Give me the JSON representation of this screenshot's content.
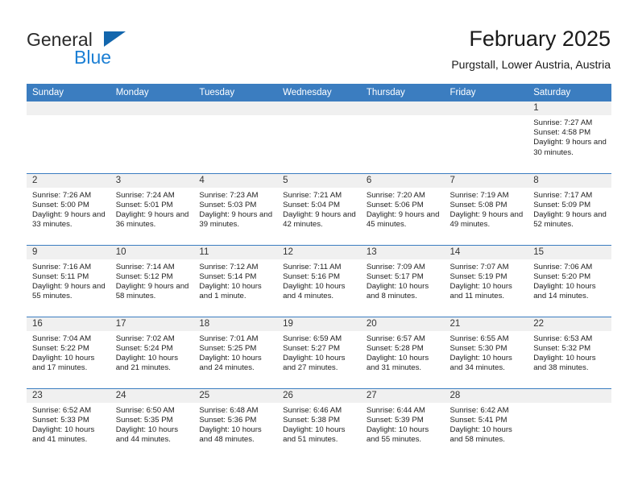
{
  "brand": {
    "name_part1": "General",
    "name_part2": "Blue",
    "triangle_color": "#1266ad",
    "blue_color": "#1b7fd4"
  },
  "header": {
    "title": "February 2025",
    "subtitle": "Purgstall, Lower Austria, Austria"
  },
  "theme": {
    "header_bar": "#3b7dc0",
    "day_band": "#f0f0f0",
    "row_rule": "#3b7dc0"
  },
  "weekdays": [
    "Sunday",
    "Monday",
    "Tuesday",
    "Wednesday",
    "Thursday",
    "Friday",
    "Saturday"
  ],
  "weeks": [
    [
      {
        "day": "",
        "sunrise": "",
        "sunset": "",
        "daylight": "",
        "empty": true
      },
      {
        "day": "",
        "sunrise": "",
        "sunset": "",
        "daylight": "",
        "empty": true
      },
      {
        "day": "",
        "sunrise": "",
        "sunset": "",
        "daylight": "",
        "empty": true
      },
      {
        "day": "",
        "sunrise": "",
        "sunset": "",
        "daylight": "",
        "empty": true
      },
      {
        "day": "",
        "sunrise": "",
        "sunset": "",
        "daylight": "",
        "empty": true
      },
      {
        "day": "",
        "sunrise": "",
        "sunset": "",
        "daylight": "",
        "empty": true
      },
      {
        "day": "1",
        "sunrise": "Sunrise: 7:27 AM",
        "sunset": "Sunset: 4:58 PM",
        "daylight": "Daylight: 9 hours and 30 minutes."
      }
    ],
    [
      {
        "day": "2",
        "sunrise": "Sunrise: 7:26 AM",
        "sunset": "Sunset: 5:00 PM",
        "daylight": "Daylight: 9 hours and 33 minutes."
      },
      {
        "day": "3",
        "sunrise": "Sunrise: 7:24 AM",
        "sunset": "Sunset: 5:01 PM",
        "daylight": "Daylight: 9 hours and 36 minutes."
      },
      {
        "day": "4",
        "sunrise": "Sunrise: 7:23 AM",
        "sunset": "Sunset: 5:03 PM",
        "daylight": "Daylight: 9 hours and 39 minutes."
      },
      {
        "day": "5",
        "sunrise": "Sunrise: 7:21 AM",
        "sunset": "Sunset: 5:04 PM",
        "daylight": "Daylight: 9 hours and 42 minutes."
      },
      {
        "day": "6",
        "sunrise": "Sunrise: 7:20 AM",
        "sunset": "Sunset: 5:06 PM",
        "daylight": "Daylight: 9 hours and 45 minutes."
      },
      {
        "day": "7",
        "sunrise": "Sunrise: 7:19 AM",
        "sunset": "Sunset: 5:08 PM",
        "daylight": "Daylight: 9 hours and 49 minutes."
      },
      {
        "day": "8",
        "sunrise": "Sunrise: 7:17 AM",
        "sunset": "Sunset: 5:09 PM",
        "daylight": "Daylight: 9 hours and 52 minutes."
      }
    ],
    [
      {
        "day": "9",
        "sunrise": "Sunrise: 7:16 AM",
        "sunset": "Sunset: 5:11 PM",
        "daylight": "Daylight: 9 hours and 55 minutes."
      },
      {
        "day": "10",
        "sunrise": "Sunrise: 7:14 AM",
        "sunset": "Sunset: 5:12 PM",
        "daylight": "Daylight: 9 hours and 58 minutes."
      },
      {
        "day": "11",
        "sunrise": "Sunrise: 7:12 AM",
        "sunset": "Sunset: 5:14 PM",
        "daylight": "Daylight: 10 hours and 1 minute."
      },
      {
        "day": "12",
        "sunrise": "Sunrise: 7:11 AM",
        "sunset": "Sunset: 5:16 PM",
        "daylight": "Daylight: 10 hours and 4 minutes."
      },
      {
        "day": "13",
        "sunrise": "Sunrise: 7:09 AM",
        "sunset": "Sunset: 5:17 PM",
        "daylight": "Daylight: 10 hours and 8 minutes."
      },
      {
        "day": "14",
        "sunrise": "Sunrise: 7:07 AM",
        "sunset": "Sunset: 5:19 PM",
        "daylight": "Daylight: 10 hours and 11 minutes."
      },
      {
        "day": "15",
        "sunrise": "Sunrise: 7:06 AM",
        "sunset": "Sunset: 5:20 PM",
        "daylight": "Daylight: 10 hours and 14 minutes."
      }
    ],
    [
      {
        "day": "16",
        "sunrise": "Sunrise: 7:04 AM",
        "sunset": "Sunset: 5:22 PM",
        "daylight": "Daylight: 10 hours and 17 minutes."
      },
      {
        "day": "17",
        "sunrise": "Sunrise: 7:02 AM",
        "sunset": "Sunset: 5:24 PM",
        "daylight": "Daylight: 10 hours and 21 minutes."
      },
      {
        "day": "18",
        "sunrise": "Sunrise: 7:01 AM",
        "sunset": "Sunset: 5:25 PM",
        "daylight": "Daylight: 10 hours and 24 minutes."
      },
      {
        "day": "19",
        "sunrise": "Sunrise: 6:59 AM",
        "sunset": "Sunset: 5:27 PM",
        "daylight": "Daylight: 10 hours and 27 minutes."
      },
      {
        "day": "20",
        "sunrise": "Sunrise: 6:57 AM",
        "sunset": "Sunset: 5:28 PM",
        "daylight": "Daylight: 10 hours and 31 minutes."
      },
      {
        "day": "21",
        "sunrise": "Sunrise: 6:55 AM",
        "sunset": "Sunset: 5:30 PM",
        "daylight": "Daylight: 10 hours and 34 minutes."
      },
      {
        "day": "22",
        "sunrise": "Sunrise: 6:53 AM",
        "sunset": "Sunset: 5:32 PM",
        "daylight": "Daylight: 10 hours and 38 minutes."
      }
    ],
    [
      {
        "day": "23",
        "sunrise": "Sunrise: 6:52 AM",
        "sunset": "Sunset: 5:33 PM",
        "daylight": "Daylight: 10 hours and 41 minutes."
      },
      {
        "day": "24",
        "sunrise": "Sunrise: 6:50 AM",
        "sunset": "Sunset: 5:35 PM",
        "daylight": "Daylight: 10 hours and 44 minutes."
      },
      {
        "day": "25",
        "sunrise": "Sunrise: 6:48 AM",
        "sunset": "Sunset: 5:36 PM",
        "daylight": "Daylight: 10 hours and 48 minutes."
      },
      {
        "day": "26",
        "sunrise": "Sunrise: 6:46 AM",
        "sunset": "Sunset: 5:38 PM",
        "daylight": "Daylight: 10 hours and 51 minutes."
      },
      {
        "day": "27",
        "sunrise": "Sunrise: 6:44 AM",
        "sunset": "Sunset: 5:39 PM",
        "daylight": "Daylight: 10 hours and 55 minutes."
      },
      {
        "day": "28",
        "sunrise": "Sunrise: 6:42 AM",
        "sunset": "Sunset: 5:41 PM",
        "daylight": "Daylight: 10 hours and 58 minutes."
      },
      {
        "day": "",
        "sunrise": "",
        "sunset": "",
        "daylight": "",
        "empty": true
      }
    ]
  ]
}
